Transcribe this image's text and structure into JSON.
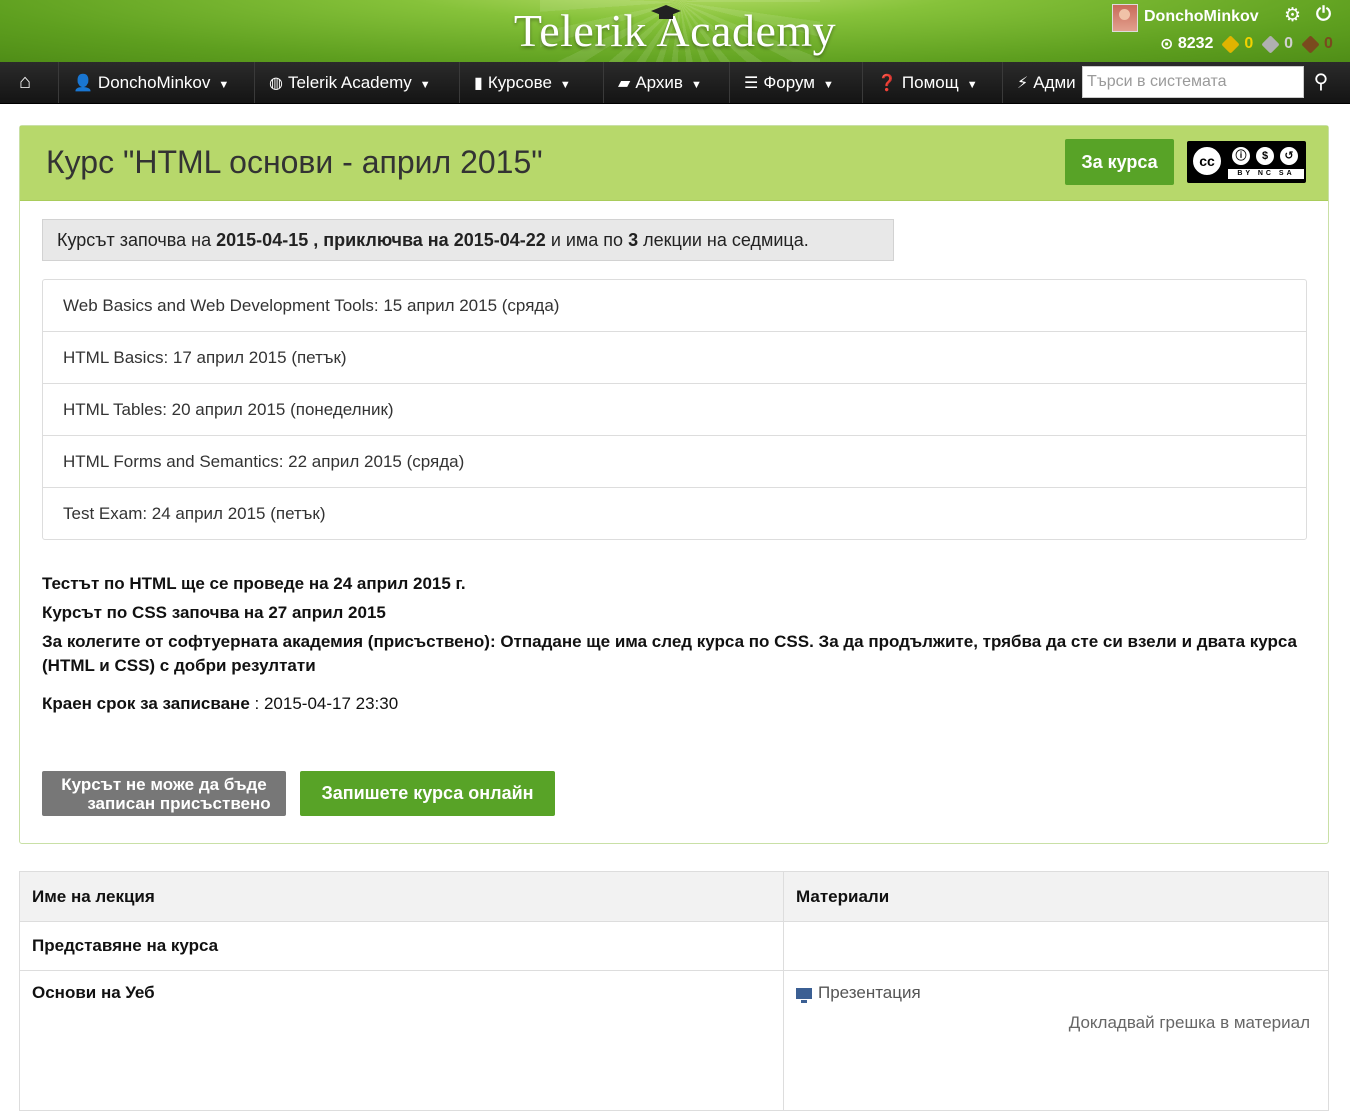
{
  "header": {
    "logo_text": "Telerik Academy",
    "user_name": "DonchoMinkov",
    "points": "8232",
    "badges": [
      {
        "count": "0",
        "color": "#e0b400"
      },
      {
        "count": "0",
        "color": "#b0b0b0"
      },
      {
        "count": "0",
        "color": "#7a4a1e"
      }
    ]
  },
  "nav": {
    "items": [
      {
        "label": "",
        "icon": "home-icon"
      },
      {
        "label": "DonchoMinkov",
        "icon": "user-icon"
      },
      {
        "label": "Telerik Academy",
        "icon": "globe-icon"
      },
      {
        "label": "Курсове",
        "icon": "book-icon"
      },
      {
        "label": "Архив",
        "icon": "folder-icon"
      },
      {
        "label": "Форум",
        "icon": "list-icon"
      },
      {
        "label": "Помощ",
        "icon": "question-icon"
      },
      {
        "label": "Адми",
        "icon": "bolt-icon"
      }
    ],
    "search_placeholder": "Търси в системата"
  },
  "course": {
    "title": "Курс \"HTML основи - април 2015\"",
    "about_button": "За курса",
    "license": {
      "main": "cc",
      "strip": "BY NC SA"
    },
    "info": {
      "prefix": "Курсът започва на",
      "start": "2015-04-15",
      "mid": ", приключва на",
      "end": "2015-04-22",
      "mid2": "и има по",
      "count": "3",
      "suffix": "лекции на седмица."
    },
    "lectures": [
      "Web Basics and Web Development Tools: 15 април 2015 (сряда)",
      "HTML Basics: 17 април 2015 (петък)",
      "HTML Tables: 20 април 2015 (понеделник)",
      "HTML Forms and Semantics: 22 април 2015 (сряда)",
      "Test Exam: 24 април 2015 (петък)"
    ],
    "notes": [
      "Тестът по HTML ще се проведе на 24 април 2015 г.",
      "Курсът по CSS започва на 27 април 2015",
      "За колегите от софтуерната академия (присъствено): Отпадане ще има след курса по CSS. За да продължите, трябва да сте си взели и двата курса (HTML и CSS) с добри резултати"
    ],
    "deadline_label": "Краен срок за записване",
    "deadline_value": ": 2015-04-17 23:30",
    "offline_button_line1": "Курсът не може да бъде",
    "offline_button_line2": "записан присъствено",
    "online_button": "Запишете курса онлайн"
  },
  "table": {
    "headers": [
      "Име на лекция",
      "Материали"
    ],
    "rows": [
      {
        "name": "Представяне на курса",
        "material": ""
      },
      {
        "name": "Основи на Уеб",
        "material": "Презентация",
        "report": "Докладвай грешка в материал"
      }
    ]
  }
}
